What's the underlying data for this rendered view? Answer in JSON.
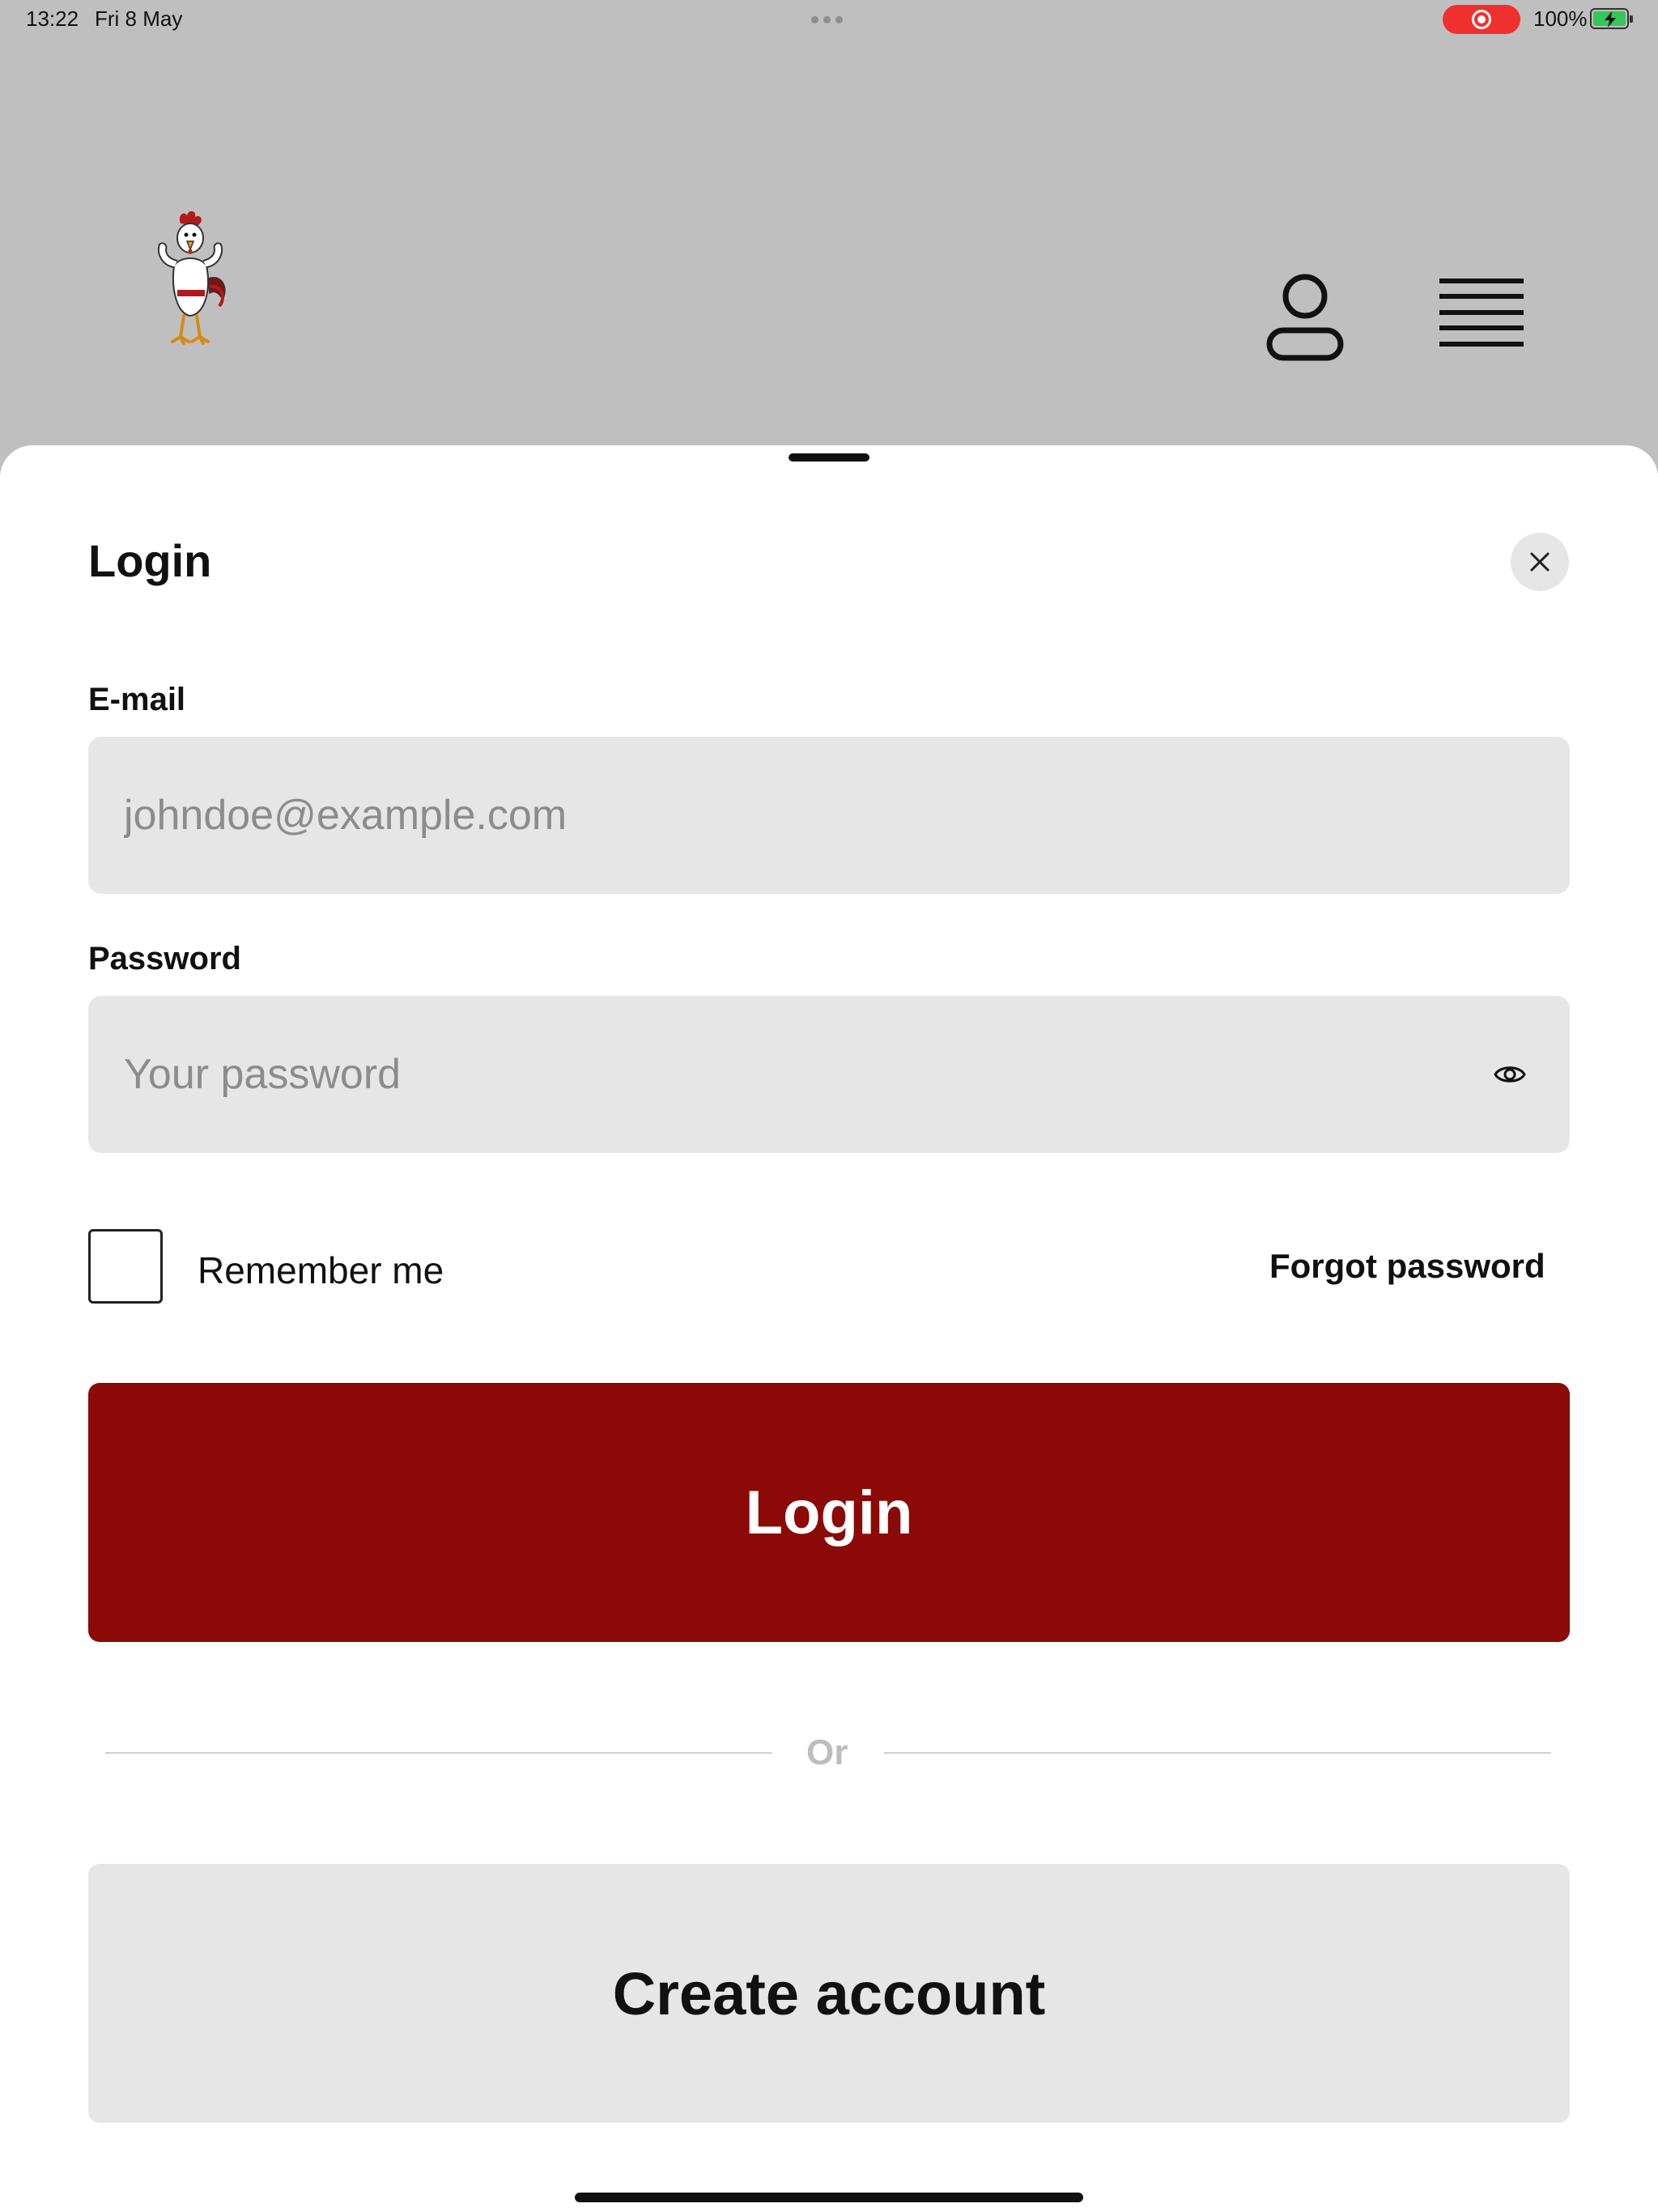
{
  "status_bar": {
    "time": "13:22",
    "date": "Fri 8 May",
    "battery_percent": "100%",
    "battery_color": "#34c759",
    "recording_indicator_color": "#f0302e"
  },
  "header": {
    "logo_icon": "rooster-mascot-logo",
    "account_icon": "user-icon",
    "menu_icon": "hamburger-menu-icon",
    "background_color": "#bfbfbf"
  },
  "login_sheet": {
    "title": "Login",
    "close_icon": "close-icon",
    "email": {
      "label": "E-mail",
      "value": "",
      "placeholder": "johndoe@example.com"
    },
    "password": {
      "label": "Password",
      "value": "",
      "placeholder": "Your password",
      "toggle_icon": "eye-icon"
    },
    "remember_me": {
      "label": "Remember me",
      "checked": false
    },
    "forgot_password_label": "Forgot password",
    "login_button_label": "Login",
    "divider_text": "Or",
    "create_account_label": "Create account",
    "accent_color": "#8b0906",
    "field_background": "#e6e6e6"
  }
}
